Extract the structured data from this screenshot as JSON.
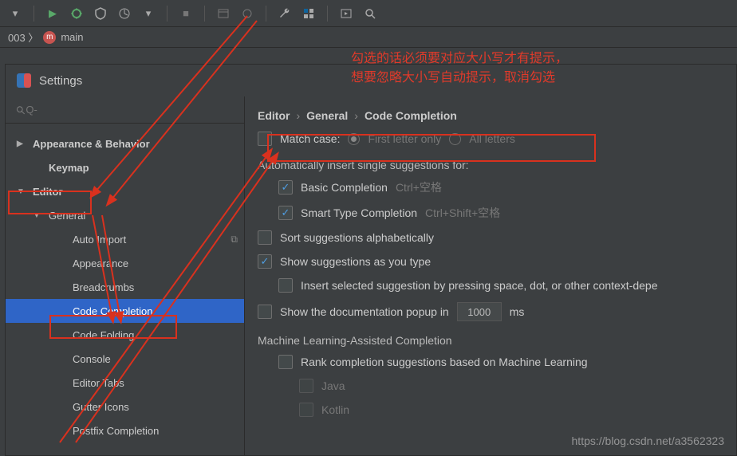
{
  "toolbar": {
    "play": "▶",
    "bug_icon": "bug",
    "stop": "■"
  },
  "crumb": {
    "prefix": "003 〉",
    "main": "main"
  },
  "settings": {
    "title": "Settings",
    "search_placeholder": "Q-"
  },
  "tree": {
    "appearance_behavior": "Appearance & Behavior",
    "keymap": "Keymap",
    "editor": "Editor",
    "general": "General",
    "auto_import": "Auto Import",
    "appearance": "Appearance",
    "breadcrumbs": "Breadcrumbs",
    "code_completion": "Code Completion",
    "code_folding": "Code Folding",
    "console": "Console",
    "editor_tabs": "Editor Tabs",
    "gutter_icons": "Gutter Icons",
    "postfix_completion": "Postfix Completion"
  },
  "breadcrumb": {
    "a": "Editor",
    "b": "General",
    "c": "Code Completion"
  },
  "options": {
    "match_case": "Match case:",
    "first_letter": "First letter only",
    "all_letters": "All letters",
    "auto_insert_header": "Automatically insert single suggestions for:",
    "basic": "Basic Completion",
    "basic_hint": "Ctrl+空格",
    "smart": "Smart Type Completion",
    "smart_hint": "Ctrl+Shift+空格",
    "sort": "Sort suggestions alphabetically",
    "show_as_type": "Show suggestions as you type",
    "insert_selected": "Insert selected suggestion by pressing space, dot, or other context-depe",
    "show_doc": "Show the documentation popup in",
    "show_doc_ms": "1000",
    "ms_label": "ms",
    "ml_header": "Machine Learning-Assisted Completion",
    "rank_ml": "Rank completion suggestions based on Machine Learning",
    "java": "Java",
    "kotlin": "Kotlin"
  },
  "annotations": {
    "line1": "勾选的话必须要对应大小写才有提示，",
    "line2": "想要忽略大小写自动提示，取消勾选"
  },
  "watermark": "https://blog.csdn.net/a3562323"
}
